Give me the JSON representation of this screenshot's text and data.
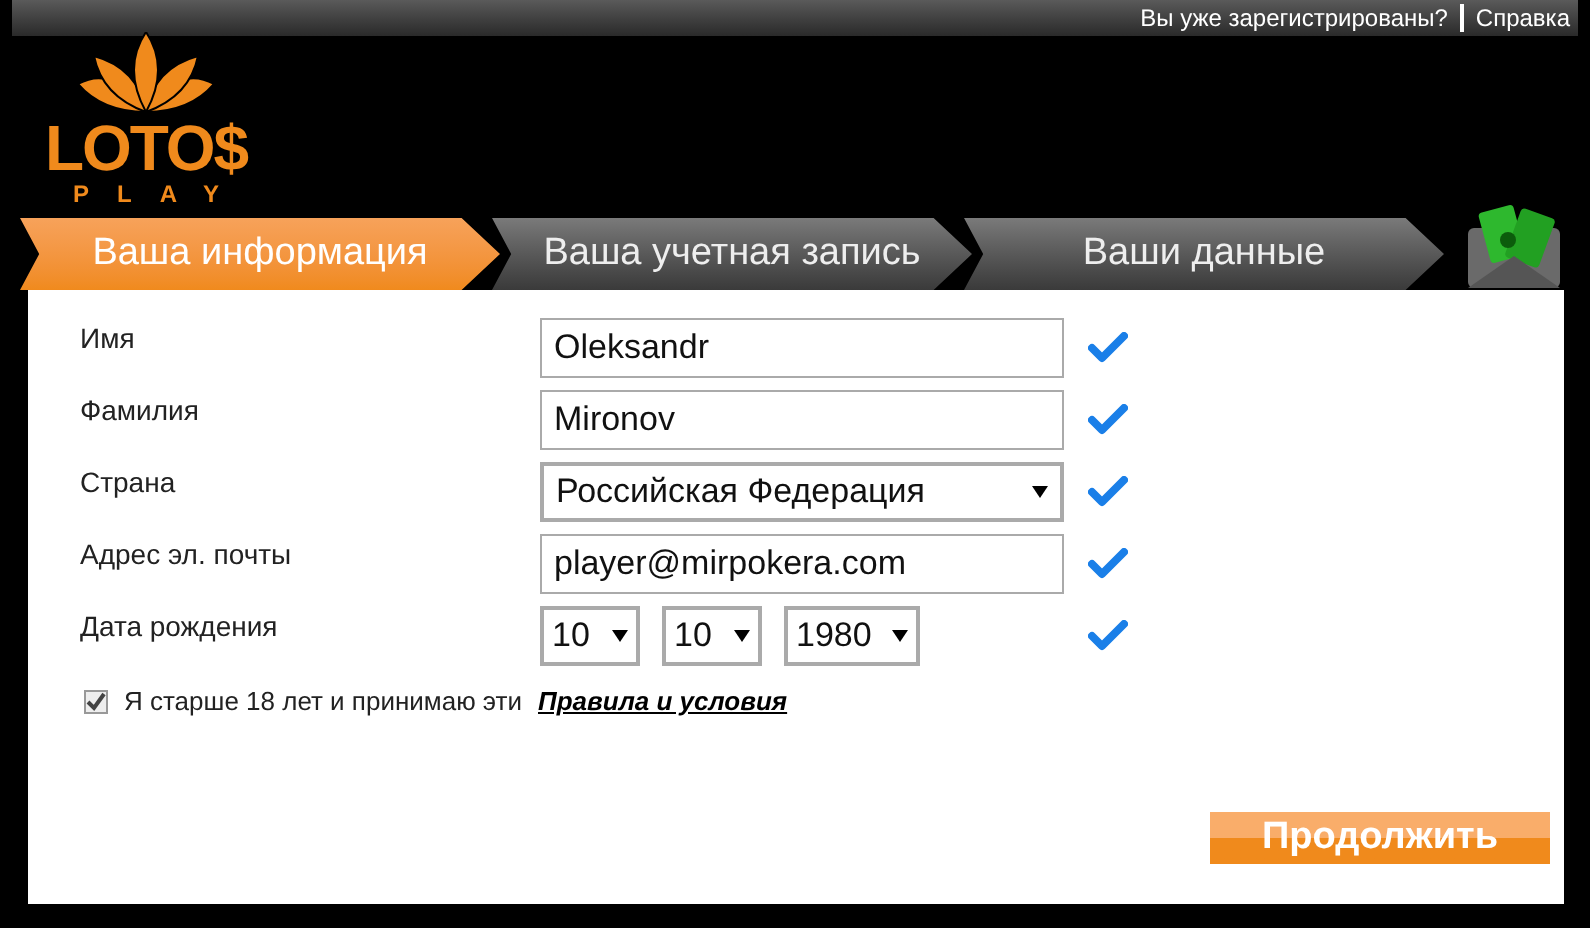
{
  "top_links": [
    "Вы уже зарегистрированы?",
    "Справка"
  ],
  "logo": {
    "word": "LOTO$",
    "sub": "PLAY"
  },
  "steps": [
    {
      "label": "Ваша информация",
      "selected": true
    },
    {
      "label": "Ваша учетная запись",
      "selected": false
    },
    {
      "label": "Ваши данные",
      "selected": false
    }
  ],
  "fields": [
    {
      "label": "Имя",
      "kind": "input",
      "value": "Oleksandr",
      "valid": true
    },
    {
      "label": "Фамилия",
      "kind": "input",
      "value": "Mironov",
      "valid": true
    },
    {
      "label": "Страна",
      "kind": "select",
      "value": "Российская Федерация",
      "valid": true
    },
    {
      "label": "Адрес эл. почты",
      "kind": "input",
      "value": "player@mirpokera.com",
      "valid": true
    },
    {
      "label": "Дата рождения",
      "kind": "date",
      "parts": [
        "10",
        "10",
        "1980"
      ],
      "valid": true
    }
  ],
  "agree": {
    "checked": true,
    "text": "Я старше 18 лет и принимаю эти",
    "link": "Правила и условия"
  },
  "continue_button": "Продолжить"
}
